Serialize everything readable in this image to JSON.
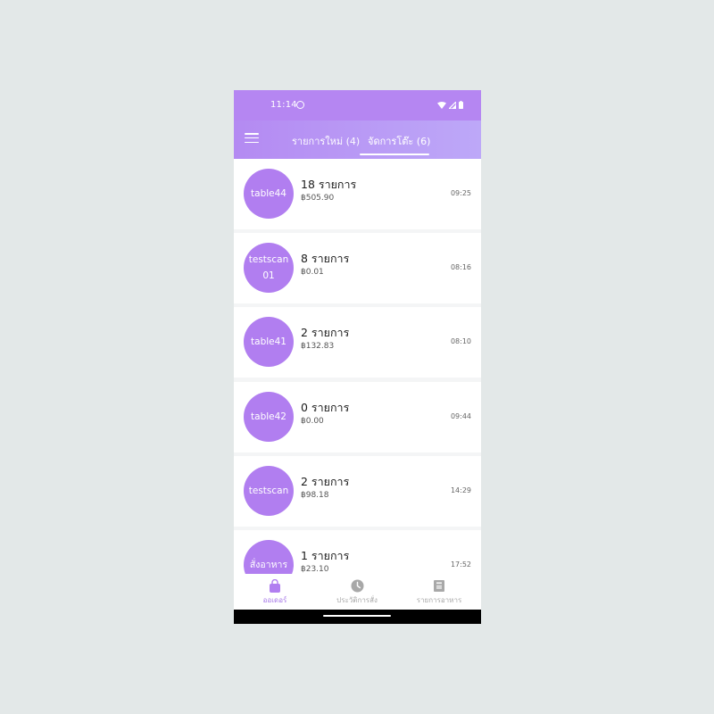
{
  "status_bar": {
    "time": "11:14"
  },
  "app_bar": {
    "tabs": [
      {
        "label": "รายการใหม่ (4)",
        "active": false
      },
      {
        "label": "จัดการโต๊ะ (6)",
        "active": true
      }
    ]
  },
  "tables": [
    {
      "name": "table44",
      "count": "18 รายการ",
      "amount": "฿505.90",
      "time": "09:25"
    },
    {
      "name": "testscan01",
      "count": "8 รายการ",
      "amount": "฿0.01",
      "time": "08:16"
    },
    {
      "name": "table41",
      "count": "2 รายการ",
      "amount": "฿132.83",
      "time": "08:10"
    },
    {
      "name": "table42",
      "count": "0 รายการ",
      "amount": "฿0.00",
      "time": "09:44"
    },
    {
      "name": "testscan",
      "count": "2 รายการ",
      "amount": "฿98.18",
      "time": "14:29"
    },
    {
      "name": "สั่งอาหาร",
      "count": "1 รายการ",
      "amount": "฿23.10",
      "time": "17:52"
    }
  ],
  "bottom_nav": {
    "items": [
      {
        "label": "ออเดอร์",
        "icon": "shopping-bag-icon",
        "active": true
      },
      {
        "label": "ประวัติการสั่ง",
        "icon": "clock-icon",
        "active": false
      },
      {
        "label": "รายการอาหาร",
        "icon": "menu-book-icon",
        "active": false
      }
    ]
  },
  "colors": {
    "accent": "#b17ef0",
    "header_start": "#b48af2",
    "header_end": "#bda8f8",
    "active_nav": "#a77ae8",
    "inactive_nav": "#a8a8a8"
  }
}
